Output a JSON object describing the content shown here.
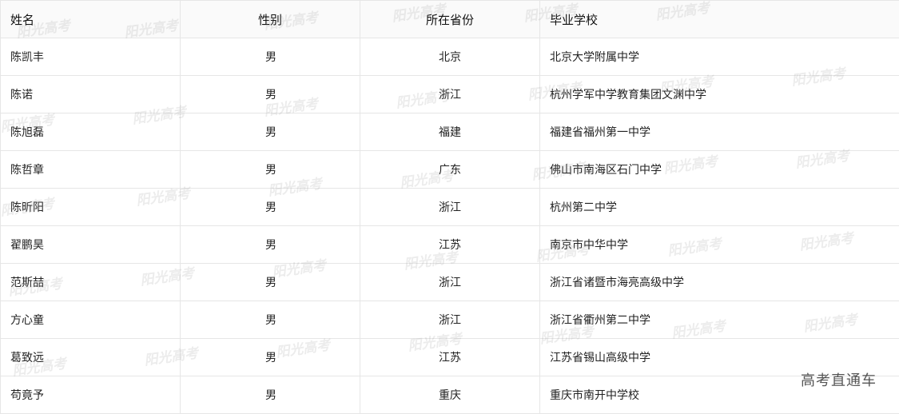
{
  "table": {
    "headers": {
      "name": "姓名",
      "gender": "性别",
      "province": "所在省份",
      "school": "毕业学校"
    },
    "rows": [
      {
        "name": "陈凯丰",
        "gender": "男",
        "province": "北京",
        "school": "北京大学附属中学"
      },
      {
        "name": "陈诺",
        "gender": "男",
        "province": "浙江",
        "school": "杭州学军中学教育集团文渊中学"
      },
      {
        "name": "陈旭磊",
        "gender": "男",
        "province": "福建",
        "school": "福建省福州第一中学"
      },
      {
        "name": "陈哲章",
        "gender": "男",
        "province": "广东",
        "school": "佛山市南海区石门中学"
      },
      {
        "name": "陈昕阳",
        "gender": "男",
        "province": "浙江",
        "school": "杭州第二中学"
      },
      {
        "name": "翟鹏昊",
        "gender": "男",
        "province": "江苏",
        "school": "南京市中华中学"
      },
      {
        "name": "范斯喆",
        "gender": "男",
        "province": "浙江",
        "school": "浙江省诸暨市海亮高级中学"
      },
      {
        "name": "方心童",
        "gender": "男",
        "province": "浙江",
        "school": "浙江省衢州第二中学"
      },
      {
        "name": "葛致远",
        "gender": "男",
        "province": "江苏",
        "school": "江苏省锡山高级中学"
      },
      {
        "name": "苟竟予",
        "gender": "男",
        "province": "重庆",
        "school": "重庆市南开中学校"
      }
    ]
  },
  "watermark_text": "阳光高考",
  "brand_text": "高考直通车"
}
